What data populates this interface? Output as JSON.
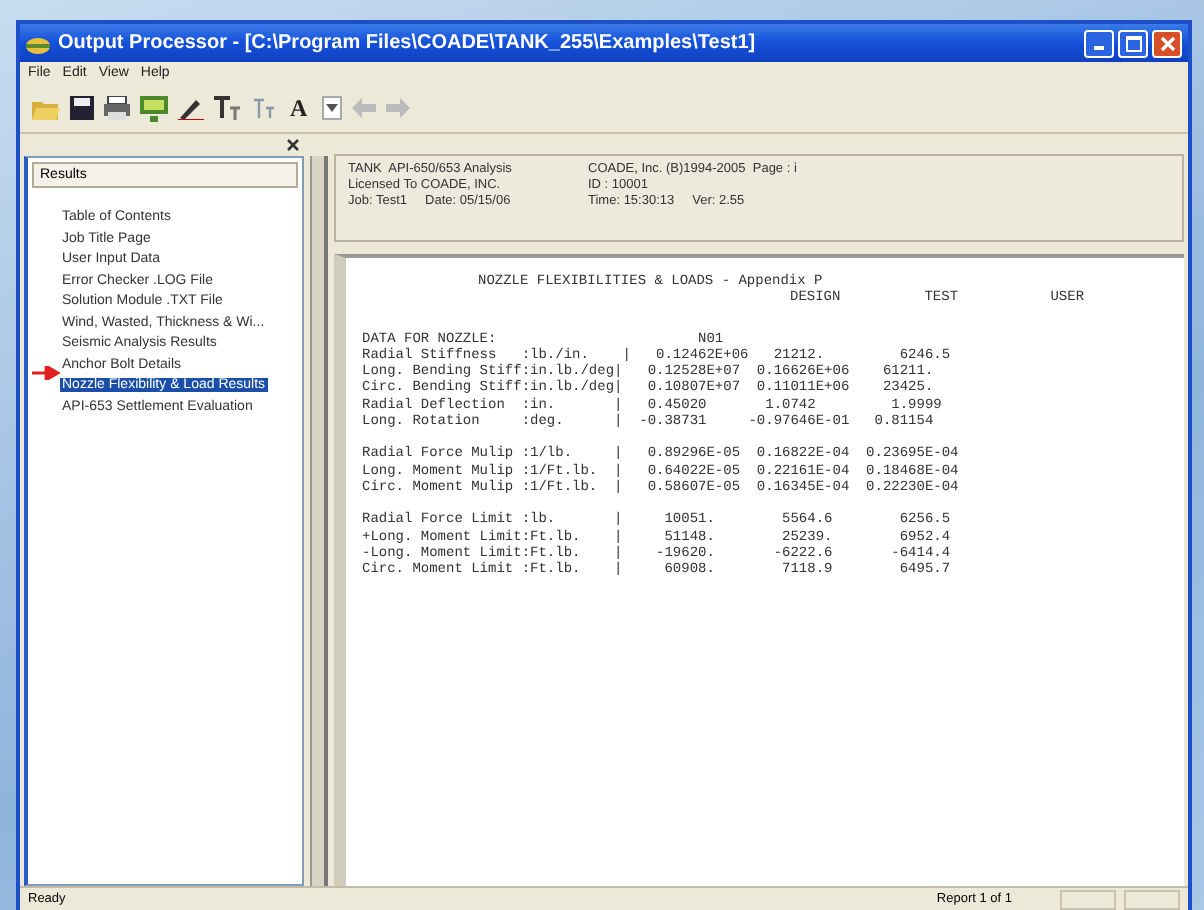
{
  "window": {
    "title": "Output Processor - [C:\\Program Files\\COADE\\TANK_255\\Examples\\Test1]"
  },
  "menu": [
    "File",
    "Edit",
    "View",
    "Help"
  ],
  "toolbar": {
    "font_button": "A"
  },
  "sidebar": {
    "header": "Results",
    "items": [
      {
        "label": "Table of Contents",
        "selected": false
      },
      {
        "label": "Job Title Page",
        "selected": false
      },
      {
        "label": "User Input Data",
        "selected": false
      },
      {
        "label": "Error Checker .LOG File",
        "selected": false
      },
      {
        "label": "Solution Module .TXT File",
        "selected": false
      },
      {
        "label": "Wind, Wasted, Thickness & Wi...",
        "selected": false
      },
      {
        "label": "Seismic Analysis Results",
        "selected": false
      },
      {
        "label": "Anchor Bolt Details",
        "selected": false
      },
      {
        "label": "Nozzle Flexibility & Load Results",
        "selected": true
      },
      {
        "label": "API-653 Settlement Evaluation",
        "selected": false
      }
    ]
  },
  "report_header": {
    "rows": [
      [
        "TANK  API-650/653 Analysis",
        "COADE, Inc. (B)1994-2005  Page : i"
      ],
      [
        "Licensed To COADE, INC.",
        "ID : 10001"
      ],
      [
        "Job: Test1     Date: 05/15/06",
        "Time: 15:30:13     Ver: 2.55"
      ]
    ]
  },
  "report": {
    "title": "NOZZLE FLEXIBILITIES & LOADS - Appendix P",
    "columns": "DESIGN          TEST           USER",
    "groups": [
      [
        "DATA FOR NOZZLE:                        N01",
        "Radial Stiffness   :lb./in.    |   0.12462E+06   21212.         6246.5",
        "Long. Bending Stiff:in.lb./deg|   0.12528E+07  0.16626E+06    61211.",
        "Circ. Bending Stiff:in.lb./deg|   0.10807E+07  0.11011E+06    23425.",
        "Radial Deflection  :in.       |   0.45020       1.0742         1.9999",
        "Long. Rotation     :deg.      |  -0.38731     -0.97646E-01   0.81154"
      ],
      [
        "Radial Force Mulip :1/lb.     |   0.89296E-05  0.16822E-04  0.23695E-04",
        "Long. Moment Mulip :1/Ft.lb.  |   0.64022E-05  0.22161E-04  0.18468E-04",
        "Circ. Moment Mulip :1/Ft.lb.  |   0.58607E-05  0.16345E-04  0.22230E-04"
      ],
      [
        "Radial Force Limit :lb.       |     10051.        5564.6        6256.5",
        "+Long. Moment Limit:Ft.lb.    |     51148.        25239.        6952.4",
        "-Long. Moment Limit:Ft.lb.    |    -19620.       -6222.6       -6414.4",
        "Circ. Moment Limit :Ft.lb.    |     60908.        7118.9        6495.7"
      ]
    ]
  },
  "status_bar": {
    "left": "Ready",
    "right": "Report 1 of 1"
  }
}
